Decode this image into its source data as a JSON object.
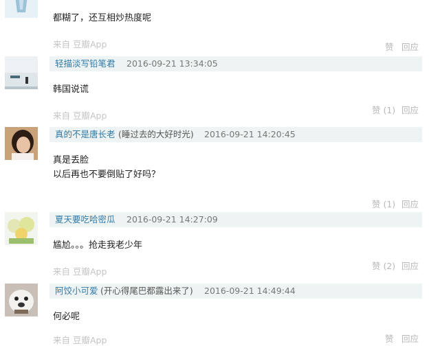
{
  "comments": [
    {
      "author": "",
      "signature": "",
      "time": "",
      "lines": [
        "都糊了，还互相炒热度呢"
      ],
      "source_prefix": "来自",
      "source_app": "豆瓣App",
      "like_label": "赞",
      "reply_label": "回应"
    },
    {
      "author": "轻描淡写铅笔君",
      "signature": "",
      "time": "2016-09-21 13:34:05",
      "lines": [
        "韩国说谎"
      ],
      "source_prefix": "来自",
      "source_app": "豆瓣App",
      "like_label": "赞 (1)",
      "reply_label": "回应"
    },
    {
      "author": "真的不是唐长老",
      "signature": "(睡过去的大好时光)",
      "time": "2016-09-21 14:20:45",
      "lines": [
        "真是丢脸",
        "以后再也不要倒贴了好吗？"
      ],
      "source_prefix": "",
      "source_app": "",
      "like_label": "赞 (1)",
      "reply_label": "回应"
    },
    {
      "author": "夏天要吃哈密瓜",
      "signature": "",
      "time": "2016-09-21 14:27:09",
      "lines": [
        "尴尬。。。抢走我老少年"
      ],
      "source_prefix": "来自",
      "source_app": "豆瓣App",
      "like_label": "赞 (2)",
      "reply_label": "回应"
    },
    {
      "author": "阿饺小可爱",
      "signature": "(开心得尾巴都露出来了)",
      "time": "2016-09-21 14:49:44",
      "lines": [
        "何必呢"
      ],
      "source_prefix": "来自",
      "source_app": "豆瓣App",
      "like_label": "赞",
      "reply_label": "回应"
    }
  ]
}
